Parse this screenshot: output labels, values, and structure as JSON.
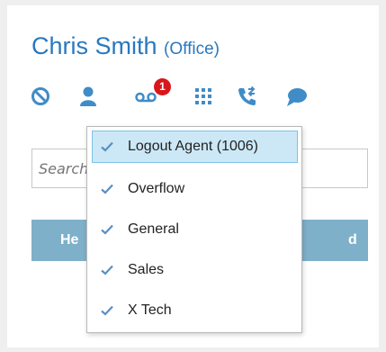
{
  "contact": {
    "name": "Chris Smith",
    "location": "(Office)"
  },
  "toolbar": {
    "icons": [
      "block-icon",
      "agent-icon",
      "voicemail-icon",
      "dialpad-icon",
      "transfer-call-icon",
      "chat-icon"
    ],
    "voicemail_badge": "1"
  },
  "search": {
    "placeholder": "Search"
  },
  "action_bar": {
    "left_label": "He",
    "right_label": "d"
  },
  "agent_menu": {
    "items": [
      {
        "label": "Logout Agent (1006)",
        "checked": true,
        "selected": true
      },
      {
        "label": "Overflow",
        "checked": true,
        "selected": false
      },
      {
        "label": "General",
        "checked": true,
        "selected": false
      },
      {
        "label": "Sales",
        "checked": true,
        "selected": false
      },
      {
        "label": "X Tech",
        "checked": true,
        "selected": false
      }
    ]
  },
  "colors": {
    "accent": "#2b78bd",
    "icon_blue": "#3f8cc7",
    "badge_red": "#d9171b",
    "action_bar": "#7eb0c9",
    "check": "#5a8fc1",
    "selected_bg": "#cce8f6"
  }
}
